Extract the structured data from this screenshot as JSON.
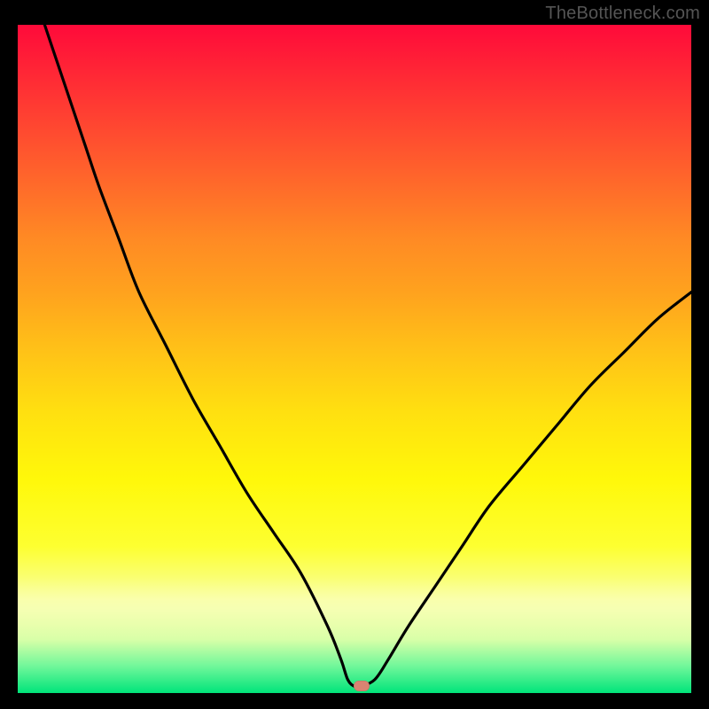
{
  "watermark": "TheBottleneck.com",
  "colors": {
    "frame": "#000000",
    "curve": "#000000",
    "marker": "#d98472",
    "gradient_top": "#ff0a3a",
    "gradient_bottom": "#00e47a"
  },
  "chart_data": {
    "type": "line",
    "title": "",
    "xlabel": "",
    "ylabel": "",
    "xlim": [
      0,
      100
    ],
    "ylim": [
      0,
      100
    ],
    "note": "Axis values are not labeled in the source image; x and y are normalized 0–100 estimates from pixel positions.",
    "series": [
      {
        "name": "bottleneck-curve",
        "x": [
          4,
          6,
          8,
          10,
          12,
          15,
          18,
          22,
          26,
          30,
          34,
          38,
          42,
          46,
          48,
          49,
          50,
          51,
          53,
          55,
          58,
          62,
          66,
          70,
          75,
          80,
          85,
          90,
          95,
          100
        ],
        "y": [
          100,
          94,
          88,
          82,
          76,
          68,
          60,
          52,
          44,
          37,
          30,
          24,
          18,
          10,
          5,
          2,
          1,
          1,
          2,
          5,
          10,
          16,
          22,
          28,
          34,
          40,
          46,
          51,
          56,
          60
        ]
      }
    ],
    "annotations": [
      {
        "name": "optimal-marker",
        "x": 51,
        "y": 1
      }
    ]
  }
}
